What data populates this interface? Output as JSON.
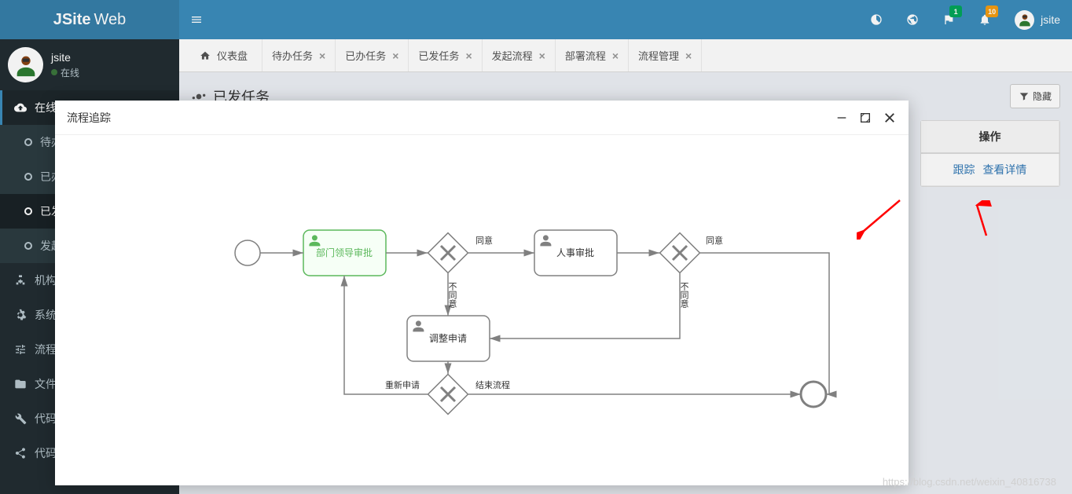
{
  "header": {
    "brand_bold": "JSite",
    "brand_light": "Web",
    "user_label": "jsite",
    "badge_notifications": "1",
    "badge_messages": "10"
  },
  "sidebar": {
    "user_name": "jsite",
    "user_status": "在线",
    "items": [
      {
        "label": "在线办公",
        "icon": "cloud"
      },
      {
        "label": "机构用户",
        "icon": "sitemap"
      },
      {
        "label": "系统设置",
        "icon": "gear"
      },
      {
        "label": "流程管理",
        "icon": "sliders"
      },
      {
        "label": "文件管理",
        "icon": "folder"
      },
      {
        "label": "代码生成",
        "icon": "wrench"
      },
      {
        "label": "代码生成",
        "icon": "share"
      }
    ],
    "sub_items": [
      {
        "label": "待办任务"
      },
      {
        "label": "已办任务"
      },
      {
        "label": "已发任务"
      },
      {
        "label": "发起流程"
      }
    ]
  },
  "tabs": [
    {
      "label": "仪表盘",
      "closable": false,
      "home": true
    },
    {
      "label": "待办任务",
      "closable": true
    },
    {
      "label": "已办任务",
      "closable": true
    },
    {
      "label": "已发任务",
      "closable": true
    },
    {
      "label": "发起流程",
      "closable": true
    },
    {
      "label": "部署流程",
      "closable": true
    },
    {
      "label": "流程管理",
      "closable": true
    }
  ],
  "page": {
    "title": "已发任务",
    "hide_btn": "隐藏",
    "table_header_ops": "操作",
    "action_track": "跟踪",
    "action_detail": "查看详情"
  },
  "modal": {
    "title": "流程追踪"
  },
  "diagram": {
    "nodes": {
      "dept_approve": "部门领导审批",
      "hr_approve": "人事审批",
      "adjust": "调整申请"
    },
    "edges": {
      "agree1": "同意",
      "agree2": "同意",
      "disagree1": "不同意",
      "disagree2": "不同意",
      "reapply": "重新申请",
      "end": "结束流程"
    }
  },
  "watermark": "https://blog.csdn.net/weixin_40816738"
}
